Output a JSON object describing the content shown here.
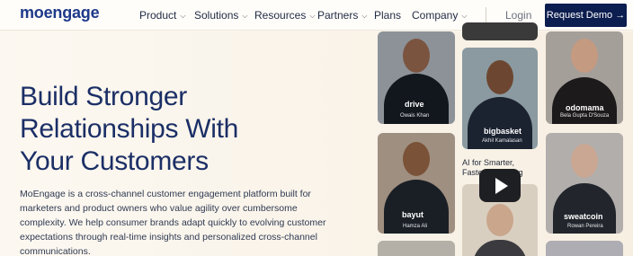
{
  "brand": {
    "logo_text": "moengage"
  },
  "nav": {
    "items": [
      {
        "label": "Product",
        "has_dropdown": true
      },
      {
        "label": "Solutions",
        "has_dropdown": true
      },
      {
        "label": "Resources",
        "has_dropdown": true
      },
      {
        "label": "Partners",
        "has_dropdown": true
      },
      {
        "label": "Plans",
        "has_dropdown": false
      },
      {
        "label": "Company",
        "has_dropdown": true
      }
    ],
    "login": "Login",
    "cta": "Request Demo →"
  },
  "hero": {
    "title_lines": [
      "Build Stronger",
      "Relationships With",
      "Your Customers"
    ],
    "description_lines": [
      "MoEngage is a cross-channel customer engagement platform built for",
      "marketers and product owners who value agility over cumbersome",
      "complexity. We help consumer brands adapt quickly to evolving customer",
      "expectations through real-time insights and personalized cross-channel",
      "communications."
    ]
  },
  "testimonials": [
    {
      "brand": "drive",
      "name": "Owais Khan"
    },
    {
      "brand": "bigbasket",
      "name": "Akhil Kamalasan"
    },
    {
      "brand": "odomama",
      "name": "Bela Gupta D'Souza"
    },
    {
      "brand": "bayut",
      "name": "Hamza Ali"
    },
    {
      "brand": "sweatcoin",
      "name": "Rowan Pereira"
    }
  ],
  "video": {
    "caption_lines": [
      "AI for Smarter,",
      "Faster Marketing"
    ]
  },
  "colors": {
    "brand": "#1e3a8a",
    "cta_bg": "#0c1d4f",
    "hero_bg": "#fbf6ee",
    "title": "#1b2f66"
  }
}
